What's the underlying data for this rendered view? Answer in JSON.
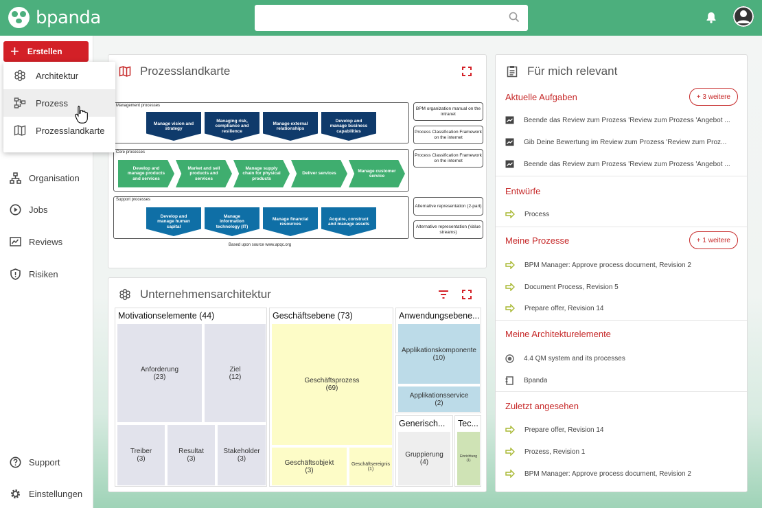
{
  "app": {
    "name": "bpanda"
  },
  "search": {
    "placeholder": ""
  },
  "sidebar": {
    "create_label": "Erstellen",
    "items": [
      {
        "label": "Organisation",
        "icon": "org-chart-icon"
      },
      {
        "label": "Jobs",
        "icon": "play-circle-icon"
      },
      {
        "label": "Reviews",
        "icon": "review-icon"
      },
      {
        "label": "Risiken",
        "icon": "shield-icon"
      }
    ],
    "bottom": [
      {
        "label": "Support",
        "icon": "help-icon"
      },
      {
        "label": "Einstellungen",
        "icon": "gear-icon"
      }
    ]
  },
  "create_menu": {
    "items": [
      {
        "label": "Architektur",
        "icon": "architecture-icon"
      },
      {
        "label": "Prozess",
        "icon": "process-icon"
      },
      {
        "label": "Prozesslandkarte",
        "icon": "map-icon"
      }
    ]
  },
  "process_map": {
    "title": "Prozesslandkarte",
    "management_label": "Management processes",
    "core_label": "Core processes",
    "support_label": "Support processes",
    "management": [
      "Manage vision and strategy",
      "Managing risk, compliance and resilience",
      "Manage external relationships",
      "Develop and manage business capabilities"
    ],
    "core": [
      "Develop and manage products and services",
      "Market and sell products and services",
      "Manage supply chain for physical products",
      "Deliver services",
      "Manage customer service"
    ],
    "support": [
      "Develop and manage human capital",
      "Manage information technology (IT)",
      "Manage financial resources",
      "Acquire, construct and manage assets"
    ],
    "side_boxes": [
      "BPM organization manual on the intranet",
      "Process Classification Framework on the internet",
      "Process Classification Framework on the internet",
      "Alternative representation (2-part)",
      "Alternative representation (Value streams)"
    ],
    "footer": "Based upon source www.apqc.org"
  },
  "architecture": {
    "title": "Unternehmensarchitektur",
    "columns": [
      {
        "header": "Motivationselemente (44)",
        "cells": [
          {
            "label": "Anforderung",
            "count": "(23)"
          },
          {
            "label": "Ziel",
            "count": "(12)"
          },
          {
            "label": "Treiber",
            "count": "(3)"
          },
          {
            "label": "Resultat",
            "count": "(3)"
          },
          {
            "label": "Stakeholder",
            "count": "(3)"
          }
        ]
      },
      {
        "header": "Geschäftsebene (73)",
        "cells": [
          {
            "label": "Geschäftsprozess",
            "count": "(69)"
          },
          {
            "label": "Geschäftsobjekt",
            "count": "(3)"
          },
          {
            "label": "Geschäftsereignis",
            "count": "(1)"
          }
        ]
      },
      {
        "header": "Anwendungsebene...",
        "cells": [
          {
            "label": "Applikationskomponente",
            "count": "(10)"
          },
          {
            "label": "Applikationsservice",
            "count": "(2)"
          }
        ]
      },
      {
        "header": "Generisch...",
        "cells": [
          {
            "label": "Gruppierung",
            "count": "(4)"
          }
        ]
      },
      {
        "header": "Tec...",
        "cells": [
          {
            "label": "Einrichtung",
            "count": "(1)"
          }
        ]
      }
    ]
  },
  "relevant": {
    "title": "Für mich relevant",
    "sections": [
      {
        "title": "Aktuelle Aufgaben",
        "more": "+ 3 weitere",
        "items": [
          "Beende das Review zum Prozess 'Review zum Prozess 'Angebot ...",
          "Gib Deine Bewertung im Review zum Prozess 'Review zum Proz...",
          "Beende das Review zum Prozess 'Review zum Prozess 'Angebot ..."
        ]
      },
      {
        "title": "Entwürfe",
        "more": "",
        "items": [
          "Process"
        ]
      },
      {
        "title": "Meine Prozesse",
        "more": "+ 1 weitere",
        "items": [
          "BPM Manager: Approve process document, Revision 2",
          "Document Process, Revision 5",
          "Prepare offer, Revision 14"
        ]
      },
      {
        "title": "Meine Architekturelemente",
        "more": "",
        "items": [
          "4.4 QM system and its processes",
          "Bpanda"
        ]
      },
      {
        "title": "Zuletzt angesehen",
        "more": "",
        "items": [
          "Prepare offer, Revision 14",
          "Prozess, Revision 1",
          "BPM Manager: Approve process document, Revision 2"
        ]
      }
    ]
  },
  "colors": {
    "brand": "#4caf7d",
    "accent": "#d32027",
    "link": "#c62828"
  }
}
